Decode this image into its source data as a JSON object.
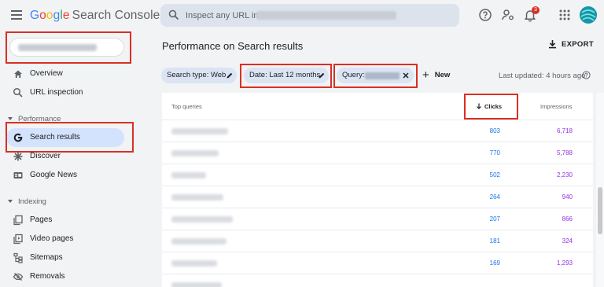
{
  "header": {
    "logo_google": [
      "G",
      "o",
      "o",
      "g",
      "l",
      "e"
    ],
    "logo_product": "Search Console",
    "search_placeholder": "Inspect any URL in",
    "notification_count": "3"
  },
  "sidebar": {
    "items": [
      {
        "label": "Overview",
        "icon": "home-icon"
      },
      {
        "label": "URL inspection",
        "icon": "search-icon"
      }
    ],
    "section_performance": "Performance",
    "performance_items": [
      {
        "label": "Search results",
        "icon": "google-g-icon"
      },
      {
        "label": "Discover",
        "icon": "asterisk-icon"
      },
      {
        "label": "Google News",
        "icon": "news-icon"
      }
    ],
    "section_indexing": "Indexing",
    "indexing_items": [
      {
        "label": "Pages",
        "icon": "pages-icon"
      },
      {
        "label": "Video pages",
        "icon": "video-pages-icon"
      },
      {
        "label": "Sitemaps",
        "icon": "sitemap-icon"
      },
      {
        "label": "Removals",
        "icon": "removals-icon"
      }
    ]
  },
  "main": {
    "title": "Performance on Search results",
    "export_label": "EXPORT",
    "filters": {
      "search_type": "Search type: Web",
      "date": "Date: Last 12 months",
      "query": "Query:",
      "new": "New"
    },
    "last_updated": "Last updated: 4 hours ago",
    "table": {
      "col_queries": "Top queries",
      "col_clicks": "Clicks",
      "col_impressions": "Impressions",
      "rows": [
        {
          "clicks": "803",
          "impressions": "6,718"
        },
        {
          "clicks": "770",
          "impressions": "5,788"
        },
        {
          "clicks": "502",
          "impressions": "2,230"
        },
        {
          "clicks": "264",
          "impressions": "940"
        },
        {
          "clicks": "207",
          "impressions": "866"
        },
        {
          "clicks": "181",
          "impressions": "324"
        },
        {
          "clicks": "169",
          "impressions": "1,293"
        }
      ]
    }
  },
  "colors": {
    "accent_blue": "#1a73e8",
    "impressions_purple": "#9334e6",
    "highlight_red": "#d93025",
    "active_nav": "#d3e3fd",
    "chip_bg": "#dbe4f3"
  }
}
